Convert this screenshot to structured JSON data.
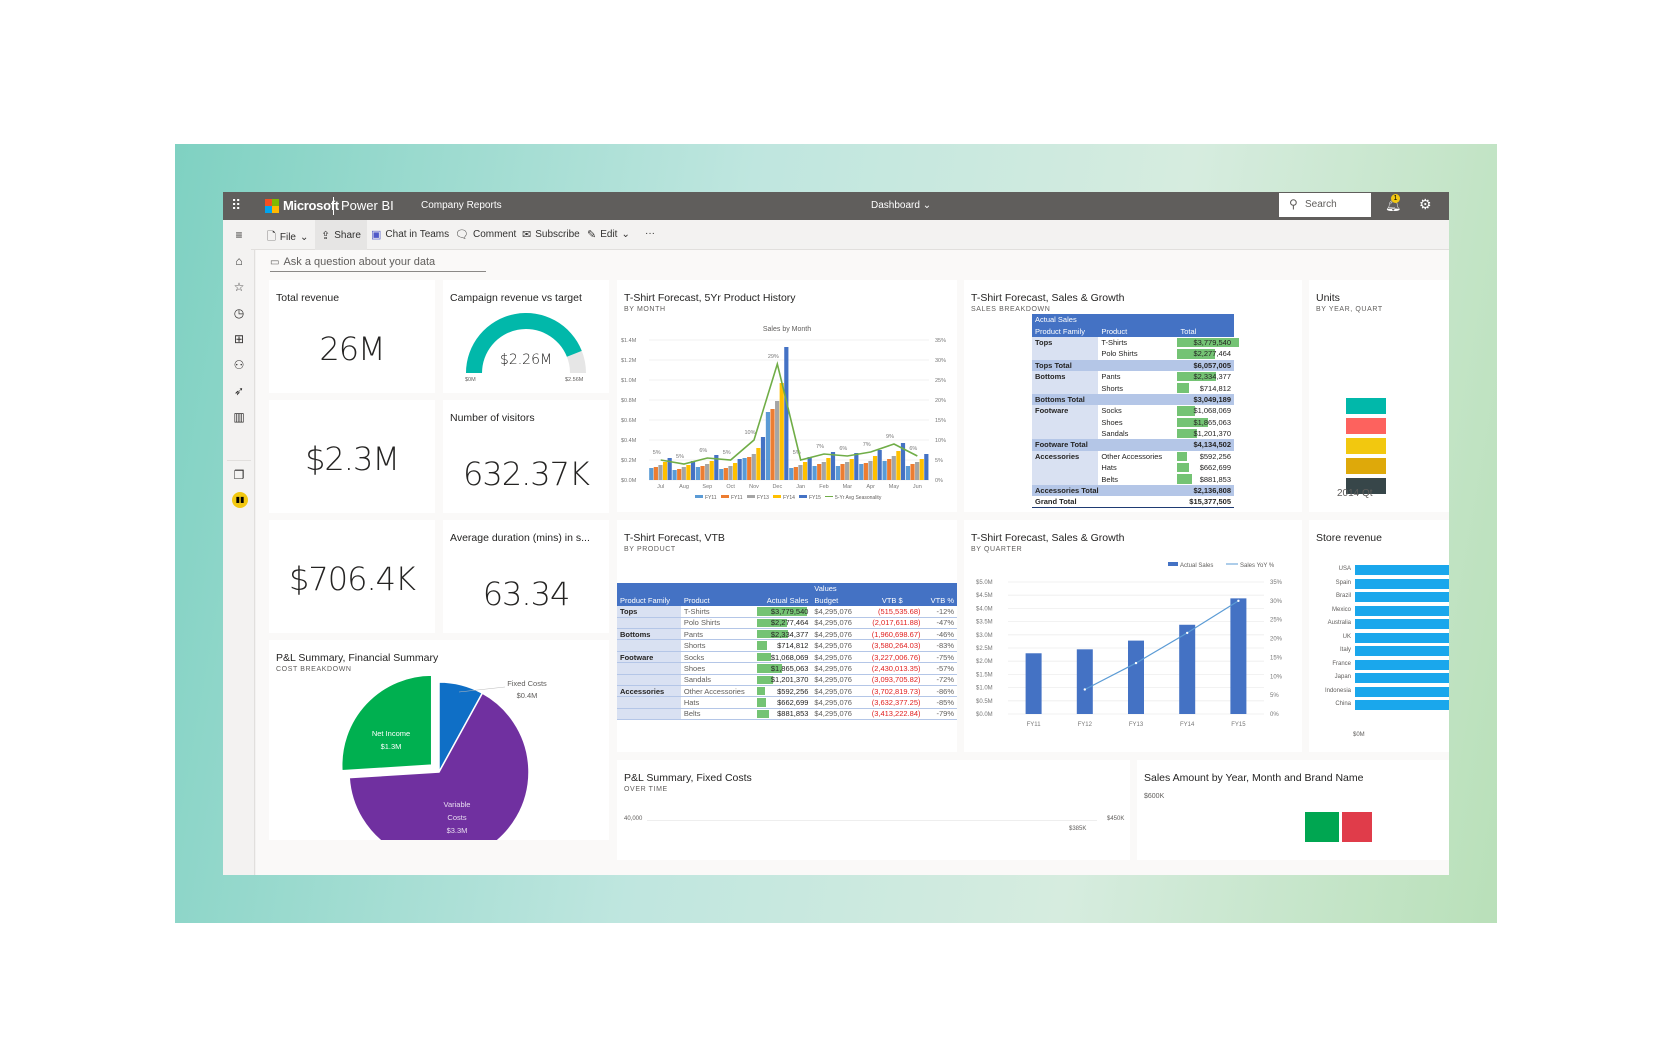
{
  "app": {
    "brand": "Microsoft",
    "product": "Power BI",
    "workspace": "Company Reports",
    "view_selector": "Dashboard",
    "search_placeholder": "Search",
    "notification_count": "1"
  },
  "toolbar": {
    "file": "File",
    "share": "Share",
    "chat_in_teams": "Chat in Teams",
    "comment": "Comment",
    "subscribe": "Subscribe",
    "edit": "Edit",
    "more": "···"
  },
  "leftnav": {
    "items": [
      "menu-icon",
      "home-icon",
      "star-icon",
      "clock-icon",
      "apps-icon",
      "shared-icon",
      "rocket-icon",
      "book-icon",
      "workspaces-icon",
      "workspace-icon"
    ]
  },
  "qa": {
    "placeholder": "Ask a question about your data"
  },
  "tiles": {
    "total_revenue": {
      "title": "Total revenue",
      "value": "26M"
    },
    "campaign": {
      "title": "Campaign revenue vs target",
      "value": "$2.26M",
      "min": "$0M",
      "max": "$2.56M",
      "fraction": 0.88
    },
    "kpi_2": {
      "value": "$2.3M"
    },
    "visitors": {
      "title": "Number of visitors",
      "value": "632.37K"
    },
    "kpi_3": {
      "value": "$706.4K"
    },
    "avg_duration": {
      "title": "Average duration (mins) in s...",
      "value": "63.34"
    },
    "history": {
      "title": "T-Shirt Forecast, 5Yr Product History",
      "subtitle": "BY MONTH"
    },
    "sales_breakdown": {
      "title": "T-Shirt Forecast, Sales & Growth",
      "subtitle": "SALES BREAKDOWN"
    },
    "units": {
      "title": "Units",
      "subtitle": "BY YEAR, QUART",
      "footer": "2014 Qt"
    },
    "vtb": {
      "title": "T-Shirt Forecast, VTB",
      "subtitle": "BY PRODUCT"
    },
    "quarter": {
      "title": "T-Shirt Forecast, Sales & Growth",
      "subtitle": "BY QUARTER"
    },
    "store_revenue": {
      "title": "Store revenue",
      "axis_label": "$0M"
    },
    "pnl_summary": {
      "title": "P&L Summary, Financial Summary",
      "subtitle": "COST BREAKDOWN"
    },
    "pnl_fixed": {
      "title": "P&L Summary, Fixed Costs",
      "subtitle": "OVER TIME",
      "left_tick": "40,000",
      "right_tick": "$450K",
      "right_tick2": "$385K"
    },
    "sales_amount": {
      "title": "Sales Amount by Year, Month and Brand Name",
      "tick": "$600K"
    }
  },
  "sales_breakdown_table": {
    "header_top": "Actual Sales",
    "columns": [
      "Product Family",
      "Product",
      "Total"
    ],
    "rows": [
      {
        "type": "item",
        "family": "Tops",
        "product": "T-Shirts",
        "total": "$3,779,540",
        "bar": 1.0
      },
      {
        "type": "item",
        "family": "",
        "product": "Polo Shirts",
        "total": "$2,277,464",
        "bar": 0.6
      },
      {
        "type": "total",
        "family": "Tops Total",
        "total": "$6,057,005"
      },
      {
        "type": "item",
        "family": "Bottoms",
        "product": "Pants",
        "total": "$2,334,377",
        "bar": 0.62
      },
      {
        "type": "item",
        "family": "",
        "product": "Shorts",
        "total": "$714,812",
        "bar": 0.19
      },
      {
        "type": "total",
        "family": "Bottoms Total",
        "total": "$3,049,189"
      },
      {
        "type": "item",
        "family": "Footware",
        "product": "Socks",
        "total": "$1,068,069",
        "bar": 0.28
      },
      {
        "type": "item",
        "family": "",
        "product": "Shoes",
        "total": "$1,865,063",
        "bar": 0.49
      },
      {
        "type": "item",
        "family": "",
        "product": "Sandals",
        "total": "$1,201,370",
        "bar": 0.32
      },
      {
        "type": "total",
        "family": "Footware Total",
        "total": "$4,134,502"
      },
      {
        "type": "item",
        "family": "Accessories",
        "product": "Other Accessories",
        "total": "$592,256",
        "bar": 0.16
      },
      {
        "type": "item",
        "family": "",
        "product": "Hats",
        "total": "$662,699",
        "bar": 0.18
      },
      {
        "type": "item",
        "family": "",
        "product": "Belts",
        "total": "$881,853",
        "bar": 0.23
      },
      {
        "type": "total",
        "family": "Accessories Total",
        "total": "$2,136,808"
      },
      {
        "type": "grand",
        "family": "Grand Total",
        "total": "$15,377,505"
      }
    ]
  },
  "vtb_table": {
    "header_top": "Values",
    "columns": [
      "Product Family",
      "Product",
      "Actual Sales",
      "Budget",
      "VTB $",
      "VTB %"
    ],
    "rows": [
      {
        "family": "Tops",
        "product": "T-Shirts",
        "actual": "$3,779,540",
        "bar": 1.0,
        "budget": "$4,295,076",
        "vtb": "(515,535.68)",
        "pct": "-12%"
      },
      {
        "family": "",
        "product": "Polo Shirts",
        "actual": "$2,277,464",
        "bar": 0.6,
        "budget": "$4,295,076",
        "vtb": "(2,017,611.88)",
        "pct": "-47%"
      },
      {
        "family": "Bottoms",
        "product": "Pants",
        "actual": "$2,334,377",
        "bar": 0.62,
        "budget": "$4,295,076",
        "vtb": "(1,960,698.67)",
        "pct": "-46%"
      },
      {
        "family": "",
        "product": "Shorts",
        "actual": "$714,812",
        "bar": 0.19,
        "budget": "$4,295,076",
        "vtb": "(3,580,264.03)",
        "pct": "-83%"
      },
      {
        "family": "Footware",
        "product": "Socks",
        "actual": "$1,068,069",
        "bar": 0.28,
        "budget": "$4,295,076",
        "vtb": "(3,227,006.76)",
        "pct": "-75%"
      },
      {
        "family": "",
        "product": "Shoes",
        "actual": "$1,865,063",
        "bar": 0.49,
        "budget": "$4,295,076",
        "vtb": "(2,430,013.35)",
        "pct": "-57%"
      },
      {
        "family": "",
        "product": "Sandals",
        "actual": "$1,201,370",
        "bar": 0.32,
        "budget": "$4,295,076",
        "vtb": "(3,093,705.82)",
        "pct": "-72%"
      },
      {
        "family": "Accessories",
        "product": "Other Accessories",
        "actual": "$592,256",
        "bar": 0.16,
        "budget": "$4,295,076",
        "vtb": "(3,702,819.73)",
        "pct": "-86%"
      },
      {
        "family": "",
        "product": "Hats",
        "actual": "$662,699",
        "bar": 0.18,
        "budget": "$4,295,076",
        "vtb": "(3,632,377.25)",
        "pct": "-85%"
      },
      {
        "family": "",
        "product": "Belts",
        "actual": "$881,853",
        "bar": 0.23,
        "budget": "$4,295,076",
        "vtb": "(3,413,222.84)",
        "pct": "-79%"
      }
    ]
  },
  "chart_data": [
    {
      "id": "history",
      "type": "bar",
      "title": "Sales by Month",
      "categories": [
        "Jul",
        "Aug",
        "Sep",
        "Oct",
        "Nov",
        "Dec",
        "Jan",
        "Feb",
        "Mar",
        "Apr",
        "May",
        "Jun"
      ],
      "series": [
        {
          "name": "FY11",
          "color": "#5b9bd5",
          "values": [
            0.12,
            0.1,
            0.13,
            0.11,
            0.22,
            0.68,
            0.12,
            0.14,
            0.14,
            0.16,
            0.19,
            0.14
          ]
        },
        {
          "name": "FY11",
          "color": "#ed7d31",
          "values": [
            0.13,
            0.11,
            0.14,
            0.12,
            0.23,
            0.71,
            0.13,
            0.16,
            0.16,
            0.17,
            0.21,
            0.16
          ]
        },
        {
          "name": "FY13",
          "color": "#a5a5a5",
          "values": [
            0.15,
            0.13,
            0.16,
            0.14,
            0.26,
            0.79,
            0.15,
            0.18,
            0.18,
            0.19,
            0.24,
            0.18
          ]
        },
        {
          "name": "FY14",
          "color": "#ffc000",
          "values": [
            0.18,
            0.15,
            0.19,
            0.17,
            0.32,
            0.97,
            0.18,
            0.22,
            0.21,
            0.24,
            0.29,
            0.21
          ]
        },
        {
          "name": "FY15",
          "color": "#4472c4",
          "values": [
            0.22,
            0.19,
            0.25,
            0.21,
            0.43,
            1.33,
            0.23,
            0.28,
            0.27,
            0.3,
            0.37,
            0.26
          ]
        }
      ],
      "line": {
        "name": "5-Yr Avg Seasonality",
        "color": "#70ad47",
        "values": [
          5,
          4,
          5.5,
          5,
          10,
          29,
          5,
          6.5,
          6,
          7,
          9,
          6
        ],
        "labels": [
          "5%",
          "5%",
          "6%",
          "5%",
          "10%",
          "29%",
          "5%",
          "7%",
          "6%",
          "7%",
          "9%",
          "6%"
        ]
      },
      "y_ticks": [
        "$0.0M",
        "$0.2M",
        "$0.4M",
        "$0.6M",
        "$0.8M",
        "$1.0M",
        "$1.2M",
        "$1.4M"
      ],
      "ylim": [
        0,
        1.4
      ],
      "y2_ticks": [
        "0%",
        "5%",
        "10%",
        "15%",
        "20%",
        "25%",
        "30%",
        "35%"
      ],
      "y2lim": [
        0,
        35
      ]
    },
    {
      "id": "quarter",
      "type": "bar",
      "categories": [
        "FY11",
        "FY12",
        "FY13",
        "FY14",
        "FY15"
      ],
      "series": [
        {
          "name": "Actual Sales",
          "color": "#4472c4",
          "values": [
            2.3,
            2.45,
            2.78,
            3.38,
            4.38
          ]
        }
      ],
      "line": {
        "name": "Sales YoY %",
        "color": "#5b9bd5",
        "values": [
          null,
          6.5,
          13.5,
          21.5,
          30
        ]
      },
      "y_ticks": [
        "$0.0M",
        "$0.5M",
        "$1.0M",
        "$1.5M",
        "$2.0M",
        "$2.5M",
        "$3.0M",
        "$3.5M",
        "$4.0M",
        "$4.5M",
        "$5.0M"
      ],
      "ylim": [
        0,
        5.0
      ],
      "y2_ticks": [
        "0%",
        "5%",
        "10%",
        "15%",
        "20%",
        "25%",
        "30%",
        "35%"
      ],
      "y2lim": [
        0,
        35
      ]
    },
    {
      "id": "pnl_pie",
      "type": "pie",
      "slices": [
        {
          "label": "Fixed Costs",
          "value": 0.4,
          "display": "$0.4M",
          "color": "#0f6fc6"
        },
        {
          "label": "Variable Costs",
          "value": 3.3,
          "display": "$3.3M",
          "color": "#7030a0"
        },
        {
          "label": "Net Income",
          "value": 1.3,
          "display": "$1.3M",
          "color": "#00b050"
        }
      ]
    },
    {
      "id": "store_revenue",
      "type": "bar",
      "orientation": "horizontal",
      "categories": [
        "USA",
        "Spain",
        "Brazil",
        "Mexico",
        "Australia",
        "UK",
        "Italy",
        "France",
        "Japan",
        "Indonesia",
        "China"
      ]
    },
    {
      "id": "units",
      "type": "bar",
      "colors": [
        "#01b8aa",
        "#fd625e",
        "#f2c80f",
        "#dea90a",
        "#374649"
      ]
    }
  ]
}
